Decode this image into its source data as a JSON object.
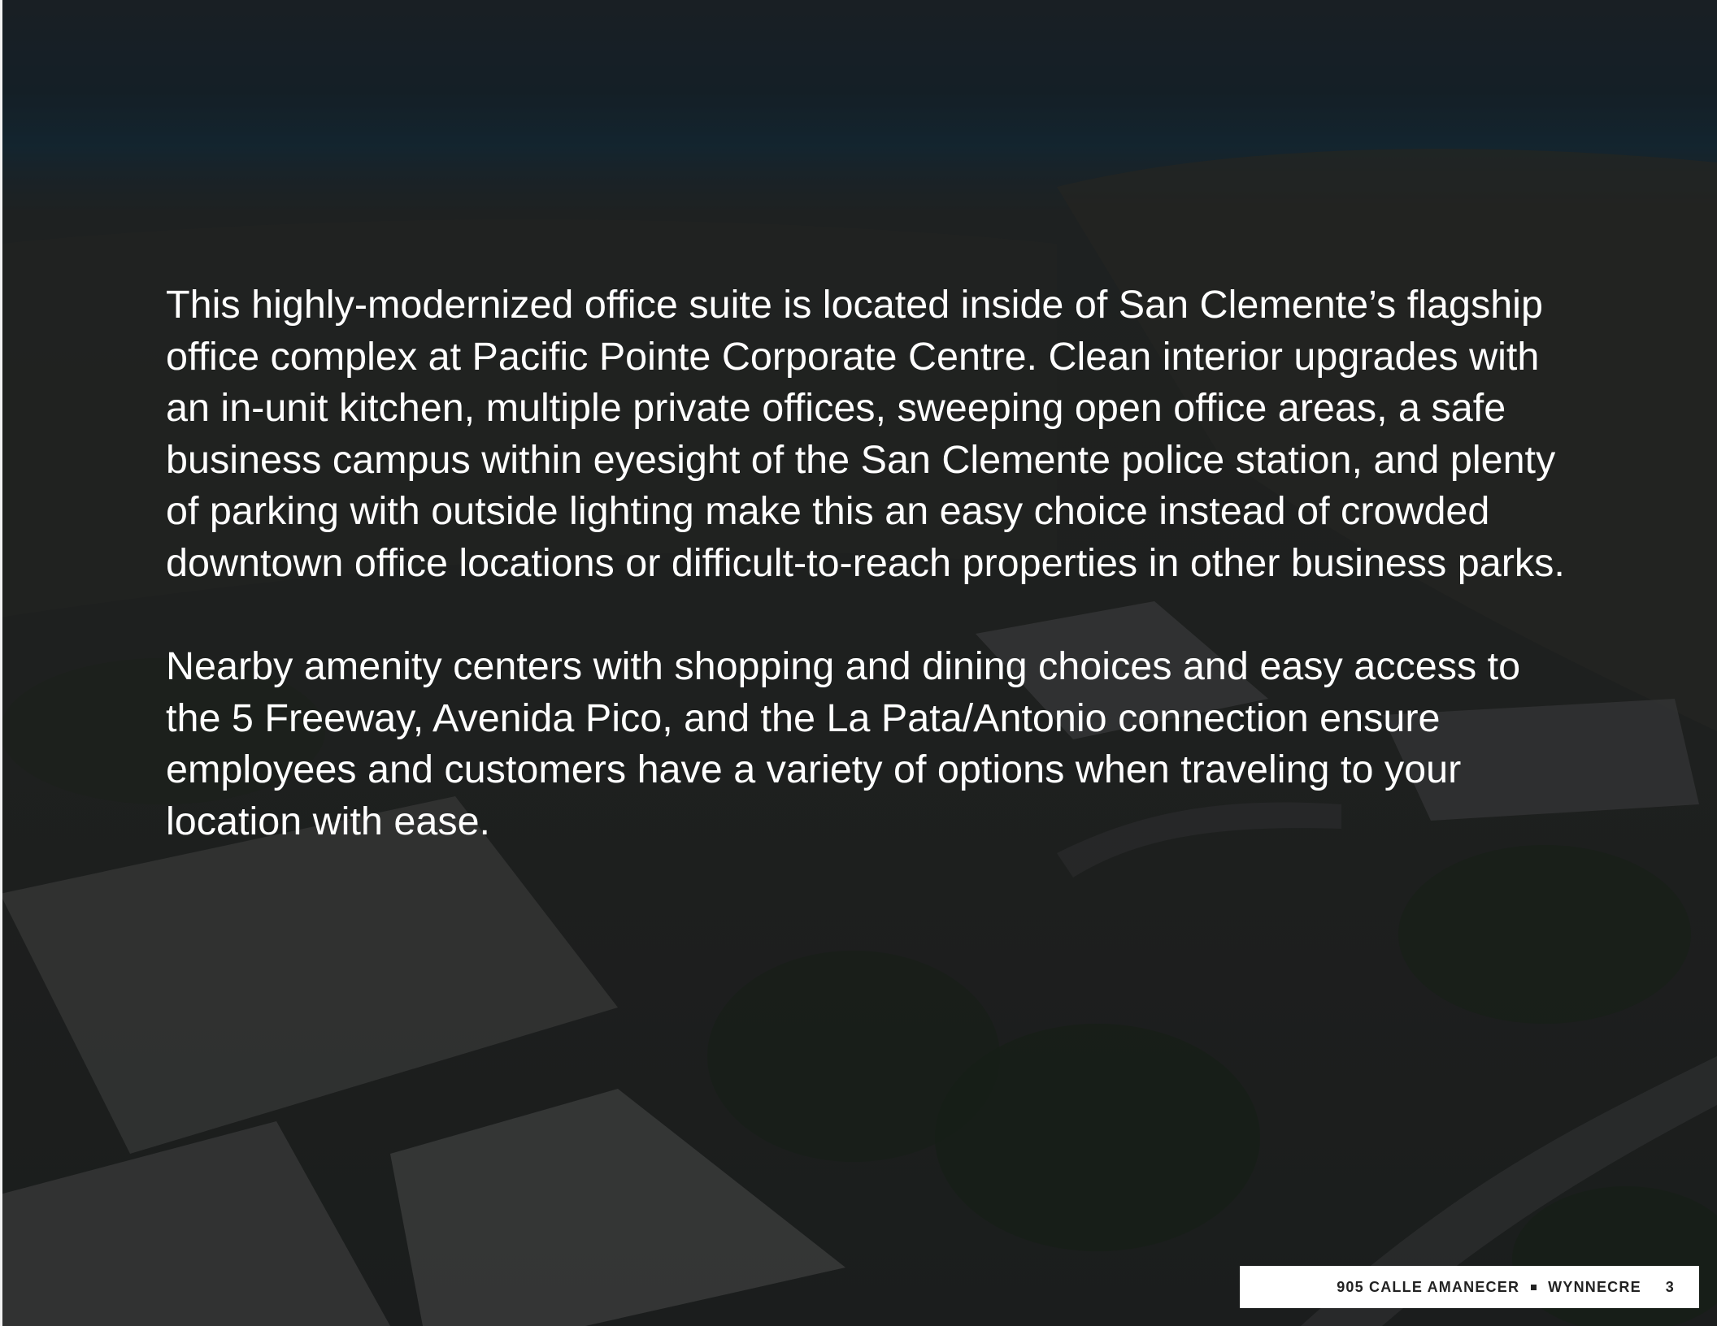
{
  "body": {
    "paragraphs": [
      "This highly-modernized office suite is located inside of San Clemente’s flagship office complex at Pacific Pointe Corporate Centre. Clean interior upgrades with an in-unit kitchen, multiple private offices, sweeping open office areas, a safe business campus within eyesight of the San Clemente police station, and plenty of parking with outside lighting make this an easy choice instead of crowded downtown office locations or difficult-to-reach properties in other business parks.",
      "Nearby amenity centers with shopping and dining choices and easy access to the 5 Freeway, Avenida Pico, and the La Pata/Antonio connection ensure employees and customers have a variety of options when traveling to your location with ease."
    ]
  },
  "footer": {
    "address": "905 CALLE AMANECER",
    "brand": "WYNNECRE",
    "page_number": "3"
  },
  "colors": {
    "text": "#ffffff",
    "footer_bg": "#ffffff",
    "footer_text": "#222222"
  }
}
